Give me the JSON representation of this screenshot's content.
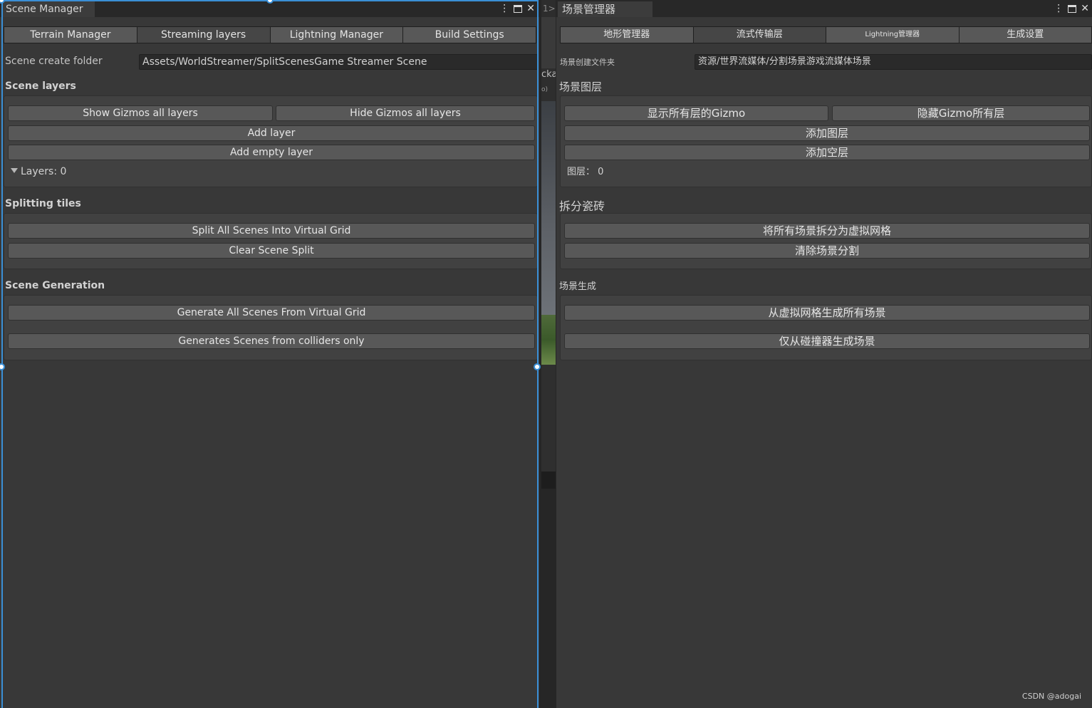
{
  "left": {
    "title": "Scene Manager",
    "tabs": [
      "Terrain Manager",
      "Streaming layers",
      "Lightning Manager",
      "Build Settings"
    ],
    "scene_folder_label": "Scene create folder",
    "scene_folder_value": "Assets/WorldStreamer/SplitScenesGame Streamer Scene",
    "scene_layers_title": "Scene layers",
    "show_gizmos": "Show Gizmos all layers",
    "hide_gizmos": "Hide Gizmos all layers",
    "add_layer": "Add layer",
    "add_empty_layer": "Add empty layer",
    "layers_count": "Layers: 0",
    "splitting_title": "Splitting tiles",
    "split_all": "Split All Scenes Into Virtual Grid",
    "clear_split": "Clear Scene Split",
    "generation_title": "Scene Generation",
    "generate_all": "Generate All Scenes From Virtual Grid",
    "generate_colliders": "Generates Scenes from colliders only"
  },
  "right": {
    "title": "场景管理器",
    "tabs": [
      "地形管理器",
      "流式传输层",
      "Lightning管理器",
      "生成设置"
    ],
    "scene_folder_label": "场景创建文件夹",
    "scene_folder_value": "资源/世界流媒体/分割场景游戏流媒体场景",
    "scene_layers_title": "场景图层",
    "show_gizmos": "显示所有层的Gizmo",
    "hide_gizmos": "隐藏Gizmo所有层",
    "add_layer": "添加图层",
    "add_empty_layer": "添加空层",
    "layers_count": "图层：  0",
    "splitting_title": "拆分瓷砖",
    "split_all": "将所有场景拆分为虚拟网格",
    "clear_split": "清除场景分割",
    "generation_title": "场景生成",
    "generate_all": "从虚拟网格生成所有场景",
    "generate_colliders": "仅从碰撞器生成场景"
  },
  "divider": {
    "tab_hint": "1>",
    "snippet_a": "cka",
    "snippet_b": "o)"
  },
  "watermark": "CSDN @adogai",
  "colors": {
    "panel": "#383838",
    "button": "#585858",
    "selection": "#3a8fd6"
  }
}
